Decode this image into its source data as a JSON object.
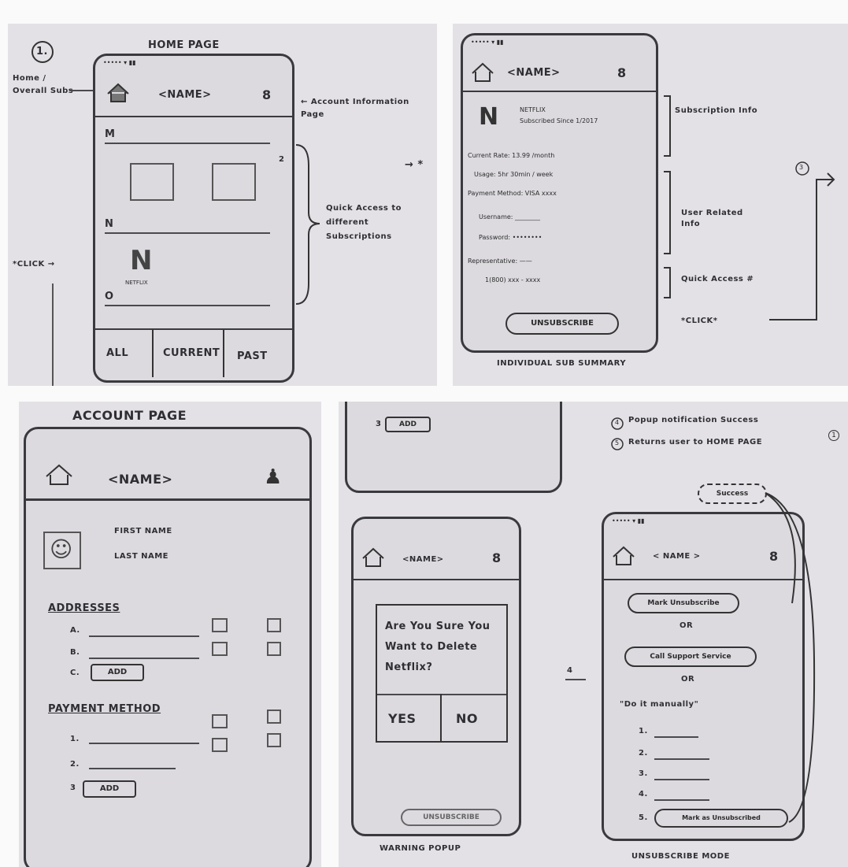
{
  "homepage": {
    "number": "1.",
    "title": "HOME PAGE",
    "left_note": "Home / Overall Subs",
    "click_note": "*CLICK →",
    "name": "<NAME>",
    "account_note": "← Account Information Page",
    "section_m": "M",
    "section_n": "N",
    "section_o": "O",
    "netflix_caption": "NETFLIX",
    "scroll_label": "2",
    "arrow_note": "→ *",
    "quick_access_note": "Quick Access to different Subscriptions",
    "tabs": [
      "ALL",
      "CURRENT",
      "PAST"
    ]
  },
  "summary": {
    "name": "<NAME>",
    "service_line1": "NETFLIX",
    "service_line2": "Subscribed Since 1/2017",
    "rows": [
      "Current Rate: 13.99 /month",
      "Usage: 5hr 30min / week",
      "Payment Method: VISA xxxx",
      "Username: ________",
      "Password: ••••••••",
      "Representative: ——",
      "1(800) xxx - xxxx"
    ],
    "unsubscribe": "UNSUBSCRIBE",
    "note_subscription": "Subscription Info",
    "note_user": "User Related Info",
    "note_quick": "Quick Access #",
    "note_click": "*CLICK*",
    "note_number": "3",
    "caption": "INDIVIDUAL SUB SUMMARY"
  },
  "account": {
    "title": "ACCOUNT PAGE",
    "name": "<NAME>",
    "first_name": "FIRST NAME",
    "last_name": "LAST NAME",
    "addresses_header": "ADDRESSES",
    "address_items": [
      "A.",
      "B.",
      "C."
    ],
    "add_label": "ADD",
    "payment_header": "PAYMENT METHOD",
    "payment_items": [
      "1.",
      "2.",
      "3"
    ]
  },
  "flow": {
    "top_fragment": "3",
    "top_add": "ADD",
    "note1": "Popup notification Success",
    "note2": "Returns user to HOME PAGE",
    "note1_num": "4",
    "note2_num": "5",
    "note_circle": "1",
    "success_label": "Success",
    "warning_name": "<NAME>",
    "popup_question": "Are You Sure You Want to Delete Netflix?",
    "yes": "YES",
    "no": "NO",
    "warning_unsub": "UNSUBSCRIBE",
    "warning_caption": "WARNING POPUP",
    "arrow_label": "4",
    "mode_name": "< NAME >",
    "mode_option1": "Mark Unsubscribe",
    "or_label": "OR",
    "mode_option2": "Call Support Service",
    "manual_label": "\"Do it manually\"",
    "steps": [
      "1.",
      "2.",
      "3.",
      "4.",
      "5."
    ],
    "mark_unsub": "Mark as Unsubscribed",
    "mode_caption": "UNSUBSCRIBE MODE"
  },
  "colors": {
    "paper": "#e3e1e6",
    "ink": "#2f2f33"
  }
}
